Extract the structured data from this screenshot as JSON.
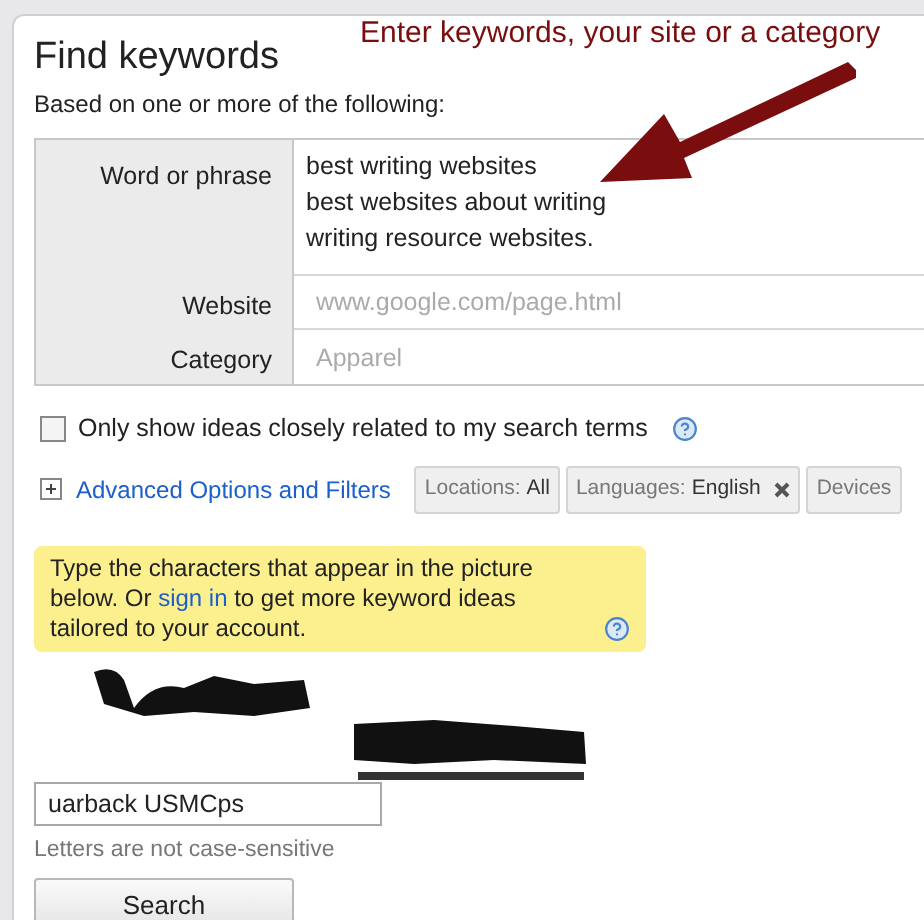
{
  "title": "Find keywords",
  "subtitle": "Based on one or more of the following:",
  "annotation": {
    "text": "Enter keywords, your site or a category"
  },
  "form": [
    {
      "label": "Word or phrase",
      "kind": "textarea",
      "value": "best writing websites\nbest websites about writing\nwriting resource websites."
    },
    {
      "label": "Website",
      "kind": "input",
      "placeholder": "www.google.com/page.html"
    },
    {
      "label": "Category",
      "kind": "input",
      "placeholder": "Apparel"
    }
  ],
  "closely_related": {
    "label": "Only show ideas closely related to my search terms",
    "checked": false
  },
  "advanced": {
    "label": "Advanced Options and Filters",
    "expanded": false
  },
  "filters": [
    {
      "name": "Locations:",
      "value": "All",
      "removable": false
    },
    {
      "name": "Languages:",
      "value": "English",
      "removable": true
    },
    {
      "name": "Devices",
      "removable": false
    }
  ],
  "notice": {
    "before": "Type the characters that appear in the picture below.",
    "link": "sign in",
    "pre_link": "Or",
    "after": "to get more keyword ideas tailored to your account."
  },
  "captcha_input": {
    "value": "uarback USMCps"
  },
  "hint": "Letters are not case-sensitive",
  "search_button": "Search"
}
